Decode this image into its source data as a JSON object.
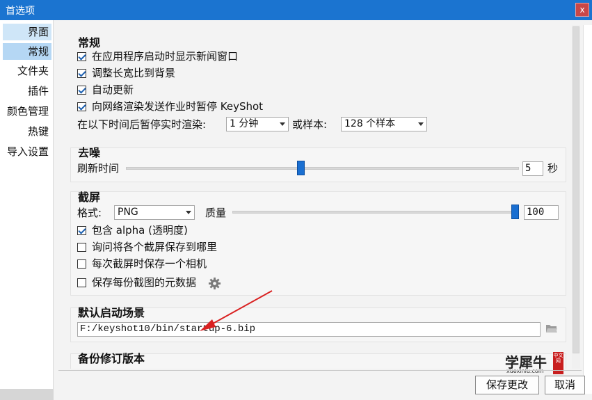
{
  "window": {
    "title": "首选项",
    "close_label": "x"
  },
  "sidebar": {
    "items": [
      {
        "label": "界面"
      },
      {
        "label": "常规"
      },
      {
        "label": "文件夹"
      },
      {
        "label": "插件"
      },
      {
        "label": "颜色管理"
      },
      {
        "label": "热键"
      },
      {
        "label": "导入设置"
      }
    ],
    "selected": "常规"
  },
  "general": {
    "title": "常规",
    "options": [
      {
        "label": "在应用程序启动时显示新闻窗口",
        "checked": true
      },
      {
        "label": "调整长宽比到背景",
        "checked": true
      },
      {
        "label": "自动更新",
        "checked": true
      },
      {
        "label": "向网络渲染发送作业时暂停 KeyShot",
        "checked": true
      }
    ],
    "pause_label": "在以下时间后暂停实时渲染:",
    "pause_time": "1 分钟",
    "or_samples_label": "或样本:",
    "samples": "128 个样本"
  },
  "denoise": {
    "title": "去噪",
    "refresh_label": "刷新时间",
    "refresh_value": "5",
    "unit": "秒"
  },
  "screenshot": {
    "title": "截屏",
    "format_label": "格式:",
    "format": "PNG",
    "quality_label": "质量",
    "quality_value": "100",
    "options": [
      {
        "label": "包含 alpha (透明度)",
        "checked": true
      },
      {
        "label": "询问将各个截屏保存到哪里",
        "checked": false
      },
      {
        "label": "每次截屏时保存一个相机",
        "checked": false
      },
      {
        "label": "保存每份截图的元数据",
        "checked": false
      }
    ]
  },
  "startup_scene": {
    "title": "默认启动场景",
    "path": "F:/keyshot10/bin/startup-6.bip"
  },
  "backup": {
    "title": "备份修订版本"
  },
  "footer": {
    "save_label": "保存更改",
    "cancel_label": "取消"
  },
  "watermark": {
    "text": "学犀牛",
    "url": "xuexiniu.com",
    "seal": "中文网"
  },
  "colors": {
    "titlebar": "#1b74d0",
    "selection": "#b5d7f4",
    "accent": "#1a6fd1",
    "arrow": "#d92020"
  }
}
